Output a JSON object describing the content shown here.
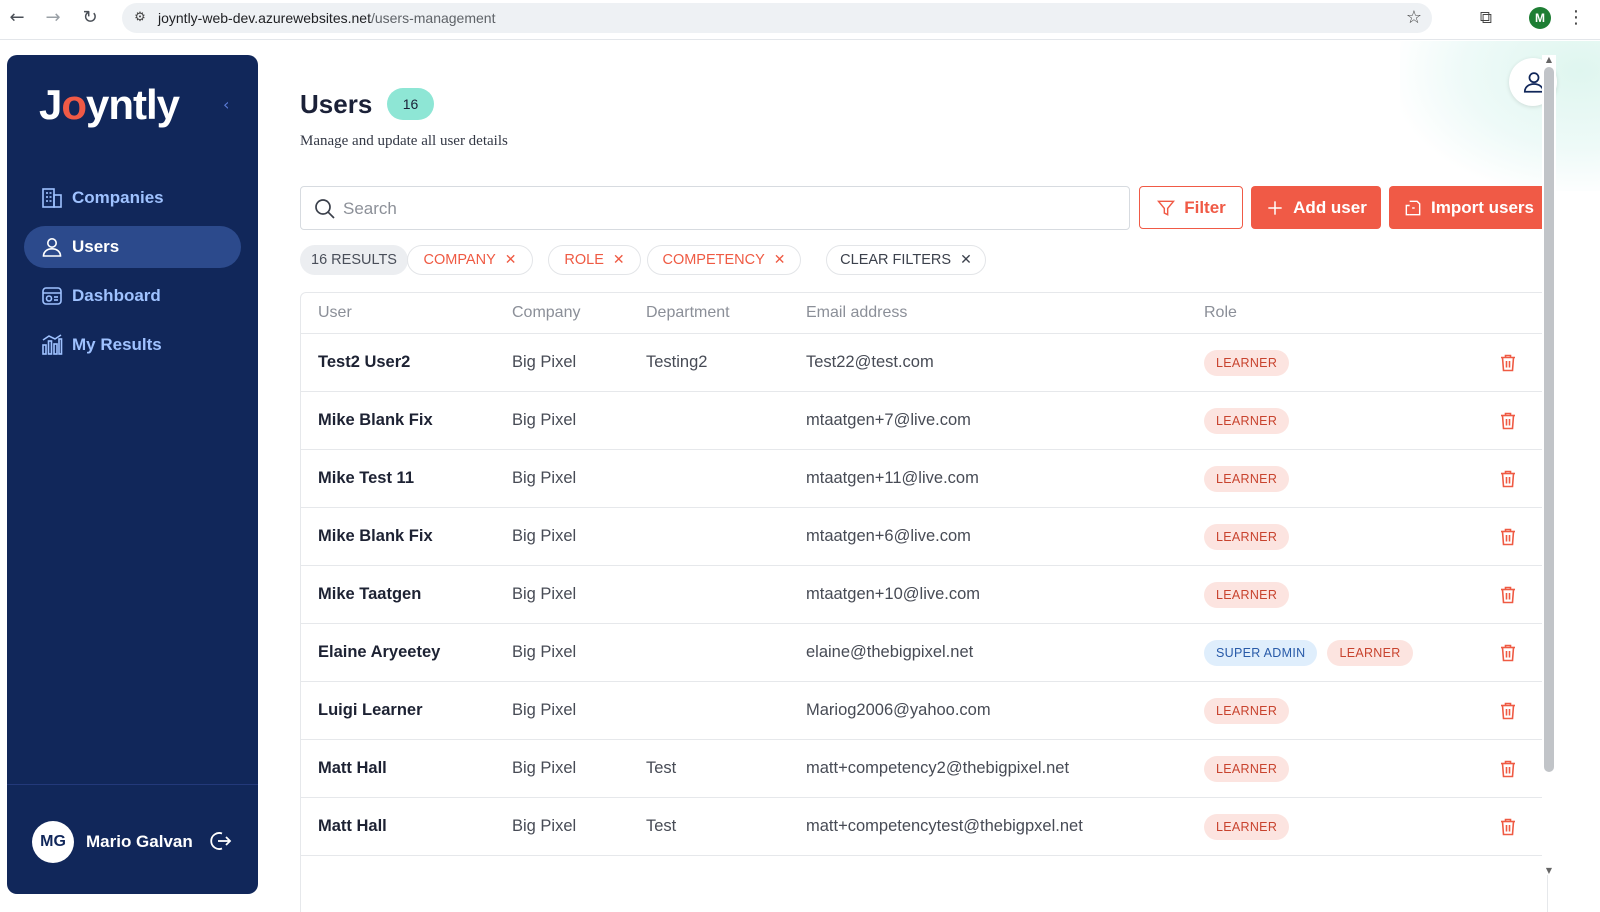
{
  "browser": {
    "url_host": "joyntly-web-dev.azurewebsites.net",
    "url_path": "/users-management",
    "profile_initial": "M"
  },
  "sidebar": {
    "logo_prefix": "J",
    "logo_dot": "o",
    "logo_suffix": "yntly",
    "items": [
      {
        "label": "Companies",
        "icon": "building-icon"
      },
      {
        "label": "Users",
        "icon": "user-icon"
      },
      {
        "label": "Dashboard",
        "icon": "dashboard-icon"
      },
      {
        "label": "My Results",
        "icon": "chart-icon"
      }
    ],
    "active_item": "Users",
    "user": {
      "initials": "MG",
      "name": "Mario Galvan"
    }
  },
  "header": {
    "title": "Users",
    "count": "16",
    "subtitle": "Manage and update all user details"
  },
  "toolbar": {
    "search_placeholder": "Search",
    "filter_label": "Filter",
    "add_label": "Add user",
    "import_label": "Import users"
  },
  "filters": {
    "results_label": "16 RESULTS",
    "chips": [
      "COMPANY",
      "ROLE",
      "COMPETENCY"
    ],
    "clear_label": "CLEAR FILTERS"
  },
  "table": {
    "columns": [
      "User",
      "Company",
      "Department",
      "Email address",
      "Role"
    ],
    "rows": [
      {
        "name": "Test2 User2",
        "company": "Big Pixel",
        "department": "Testing2",
        "email": "Test22@test.com",
        "roles": [
          "LEARNER"
        ]
      },
      {
        "name": "Mike Blank Fix",
        "company": "Big Pixel",
        "department": "",
        "email": "mtaatgen+7@live.com",
        "roles": [
          "LEARNER"
        ]
      },
      {
        "name": "Mike Test 11",
        "company": "Big Pixel",
        "department": "",
        "email": "mtaatgen+11@live.com",
        "roles": [
          "LEARNER"
        ]
      },
      {
        "name": "Mike Blank Fix",
        "company": "Big Pixel",
        "department": "",
        "email": "mtaatgen+6@live.com",
        "roles": [
          "LEARNER"
        ]
      },
      {
        "name": "Mike Taatgen",
        "company": "Big Pixel",
        "department": "",
        "email": "mtaatgen+10@live.com",
        "roles": [
          "LEARNER"
        ]
      },
      {
        "name": "Elaine Aryeetey",
        "company": "Big Pixel",
        "department": "",
        "email": "elaine@thebigpixel.net",
        "roles": [
          "SUPER ADMIN",
          "LEARNER"
        ]
      },
      {
        "name": "Luigi Learner",
        "company": "Big Pixel",
        "department": "",
        "email": "Mariog2006@yahoo.com",
        "roles": [
          "LEARNER"
        ]
      },
      {
        "name": "Matt Hall",
        "company": "Big Pixel",
        "department": "Test",
        "email": "matt+competency2@thebigpixel.net",
        "roles": [
          "LEARNER"
        ]
      },
      {
        "name": "Matt Hall",
        "company": "Big Pixel",
        "department": "Test",
        "email": "matt+competencytest@thebigpxel.net",
        "roles": [
          "LEARNER"
        ]
      }
    ]
  },
  "colors": {
    "sidebar_bg": "#11275a",
    "accent": "#f05a46",
    "badge": "#8ee6d5"
  }
}
